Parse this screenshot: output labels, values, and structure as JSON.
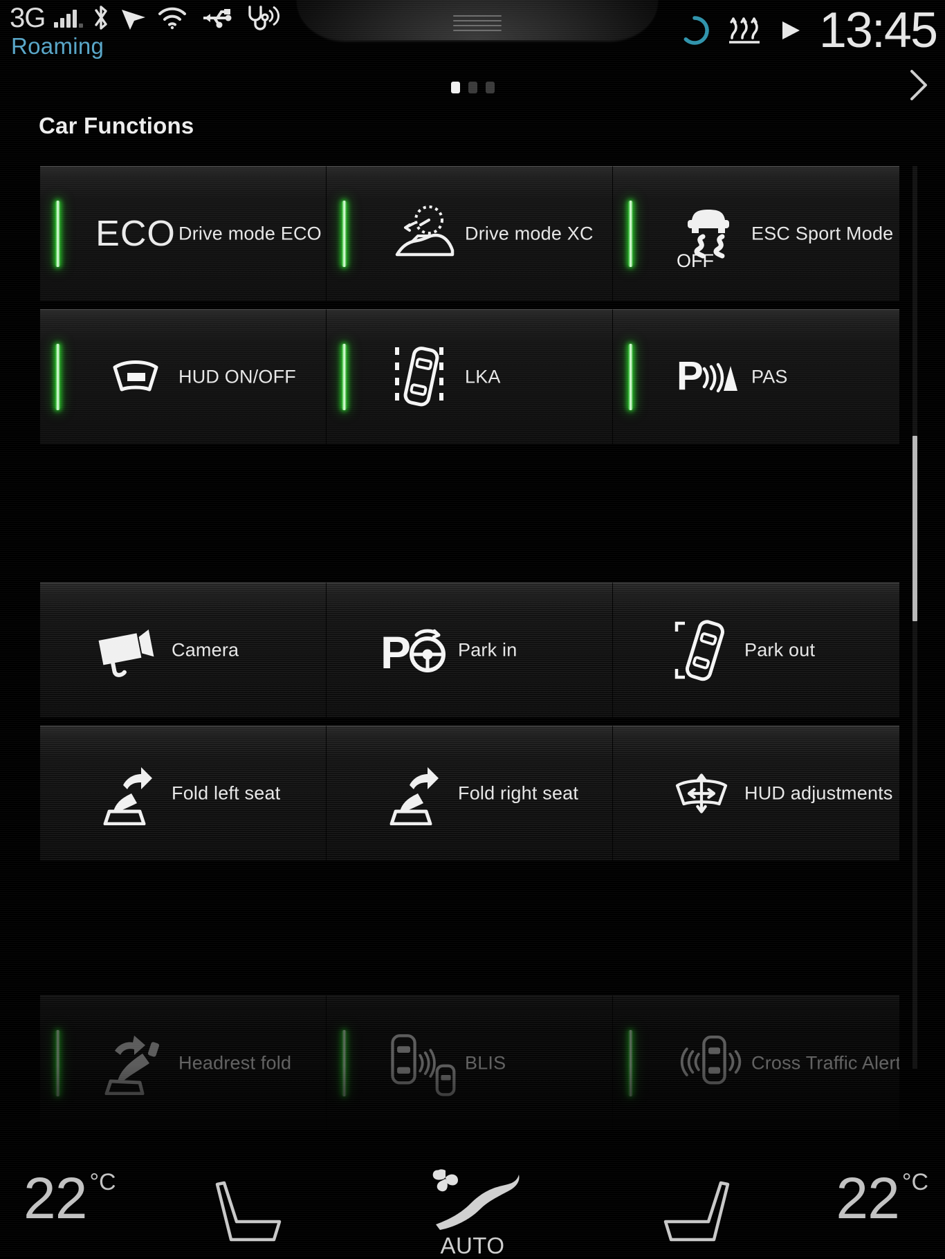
{
  "statusbar": {
    "network_label": "3G",
    "roaming_label": "Roaming",
    "clock": "13:45",
    "icons": [
      {
        "name": "signal-bars-icon"
      },
      {
        "name": "bluetooth-icon"
      },
      {
        "name": "navigation-arrow-icon"
      },
      {
        "name": "wifi-icon"
      },
      {
        "name": "usb-icon"
      },
      {
        "name": "diagnostics-icon"
      }
    ],
    "right_icons": [
      {
        "name": "loading-spinner-icon",
        "color": "#2a8fa8"
      },
      {
        "name": "seat-heating-icon"
      },
      {
        "name": "media-play-icon"
      }
    ]
  },
  "pager": {
    "total": 3,
    "active_index": 0
  },
  "header": {
    "title": "Car Functions",
    "next_arrow": "chevron-right-icon"
  },
  "theme": {
    "accent_green": "#28dc28",
    "text": "#e6e6e6",
    "roaming_blue": "#58a6c8"
  },
  "grid": {
    "group_a": [
      [
        {
          "label": "Drive mode ECO",
          "icon": "eco-text-icon",
          "indicator": true,
          "text_icon": "ECO"
        },
        {
          "label": "Drive mode XC",
          "icon": "drive-mode-xc-icon",
          "indicator": true
        },
        {
          "label": "ESC Sport Mode",
          "icon": "esc-sport-mode-icon",
          "indicator": true,
          "icon_sublabel": "OFF"
        }
      ],
      [
        {
          "label": "HUD ON/OFF",
          "icon": "hud-icon",
          "indicator": true
        },
        {
          "label": "LKA",
          "icon": "lane-keeping-aid-icon",
          "indicator": true
        },
        {
          "label": "PAS",
          "icon": "park-assist-sensor-icon",
          "indicator": true
        }
      ]
    ],
    "group_b": [
      [
        {
          "label": "Camera",
          "icon": "camera-icon",
          "indicator": false
        },
        {
          "label": "Park in",
          "icon": "park-in-icon",
          "indicator": false
        },
        {
          "label": "Park out",
          "icon": "park-out-icon",
          "indicator": false
        }
      ],
      [
        {
          "label": "Fold left seat",
          "icon": "fold-left-seat-icon",
          "indicator": false
        },
        {
          "label": "Fold right seat",
          "icon": "fold-right-seat-icon",
          "indicator": false
        },
        {
          "label": "HUD adjustments",
          "icon": "hud-adjustments-icon",
          "indicator": false
        }
      ]
    ],
    "group_c": [
      [
        {
          "label": "Headrest fold",
          "icon": "headrest-fold-icon",
          "indicator": true
        },
        {
          "label": "BLIS",
          "icon": "blis-icon",
          "indicator": true
        },
        {
          "label": "Cross Traffic Alert",
          "icon": "cross-traffic-alert-icon",
          "indicator": true
        }
      ]
    ]
  },
  "climate": {
    "left_temp": "22",
    "left_unit": "°C",
    "right_temp": "22",
    "right_unit": "°C",
    "auto_label": "AUTO",
    "left_seat_icon": "seat-icon",
    "right_seat_icon": "seat-icon",
    "fan_icon": "auto-climate-fan-icon"
  }
}
